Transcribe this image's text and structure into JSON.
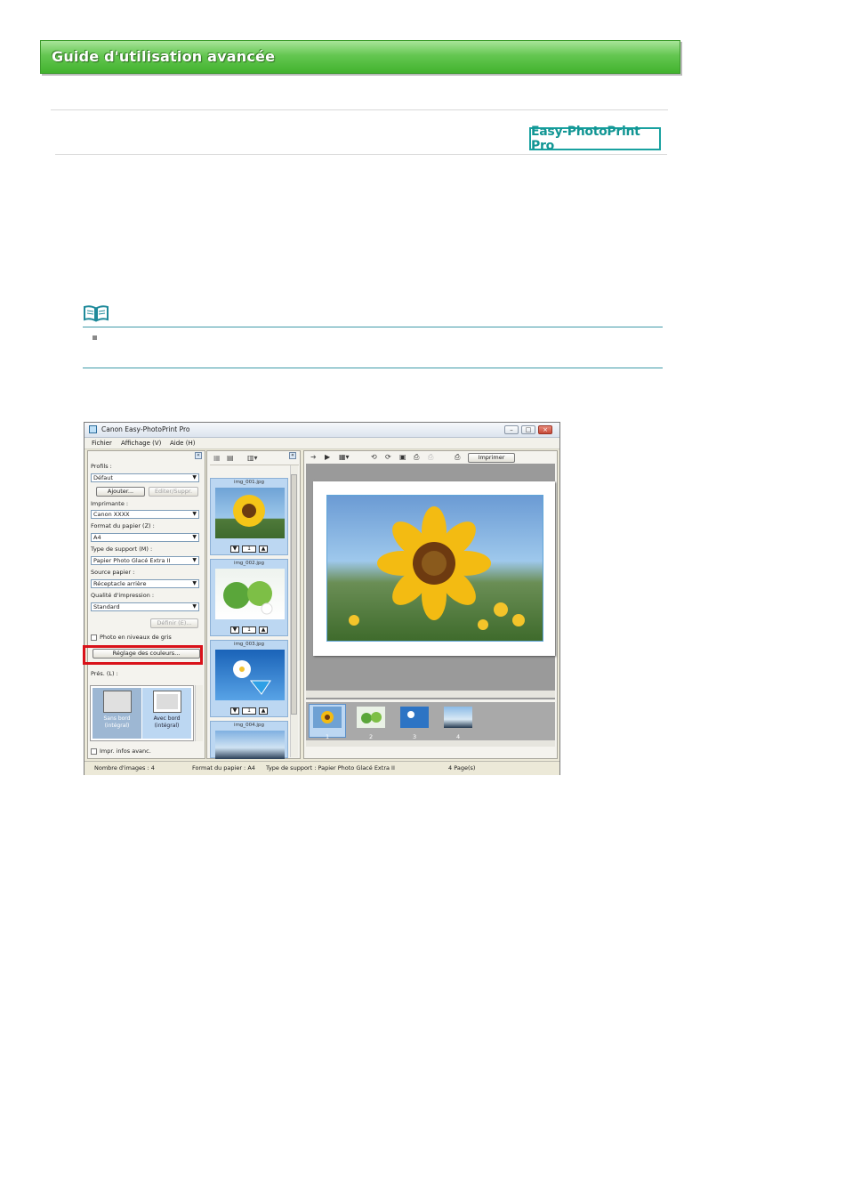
{
  "guide": {
    "title": "Guide d'utilisation avancée",
    "logo": "Easy-PhotoPrint Pro"
  },
  "window": {
    "title": "Canon Easy-PhotoPrint Pro",
    "menu": [
      "Fichier",
      "Affichage (V)",
      "Aide (H)"
    ]
  },
  "left_panel": {
    "profiles_label": "Profils :",
    "profiles_value": "Défaut",
    "add_button": "Ajouter...",
    "edit_button": "Editer/Suppr.",
    "printer_label": "Imprimante :",
    "printer_value": "Canon XXXX",
    "paper_size_label": "Format du papier (Z) :",
    "paper_size_value": "A4",
    "media_type_label": "Type de support (M) :",
    "media_type_value": "Papier Photo Glacé Extra II",
    "paper_source_label": "Source papier :",
    "paper_source_value": "Réceptacle arrière",
    "quality_label": "Qualité d'impression :",
    "quality_value": "Standard",
    "define_button": "Définir (E)...",
    "grayscale_label": "Photo en niveaux de gris",
    "color_adjust_button": "Réglage des couleurs...",
    "layout_label": "Prés. (L) :",
    "layout_options": [
      {
        "label": "Sans bord (intégral)",
        "selected": false
      },
      {
        "label": "Avec bord (intégral)",
        "selected": true
      }
    ],
    "advanced_info_label": "Impr. infos avanc."
  },
  "thumbnails": [
    {
      "file": "img_001.jpg",
      "copies": "1",
      "image": "sunflower"
    },
    {
      "file": "img_002.jpg",
      "copies": "1",
      "image": "apples"
    },
    {
      "file": "img_003.jpg",
      "copies": "1",
      "image": "flower-glass"
    },
    {
      "file": "img_004.jpg",
      "copies": "",
      "image": "palms"
    }
  ],
  "right_panel": {
    "print_button": "Imprimer",
    "pages": [
      "1",
      "2",
      "3",
      "4"
    ]
  },
  "status_bar": {
    "images": "Nombre d'images : 4",
    "paper": "Format du papier : A4",
    "media": "Type de support : Papier Photo Glacé Extra II",
    "pages": "4 Page(s)"
  },
  "colors": {
    "banner_green": "#4db83a",
    "logo_teal": "#19a1a0",
    "highlight_red": "#d9121a",
    "selection_blue": "#bcd7f2"
  }
}
